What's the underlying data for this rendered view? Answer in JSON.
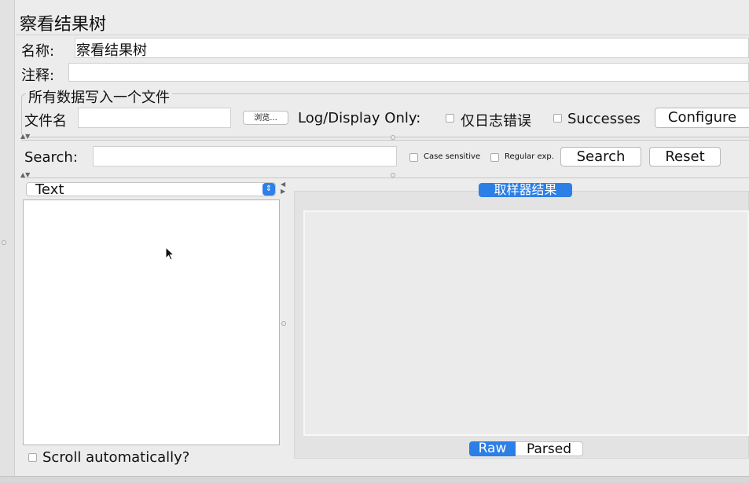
{
  "window": {
    "title": "察看结果树"
  },
  "form": {
    "name_label": "名称:",
    "name_value": "察看结果树",
    "comment_label": "注释:",
    "comment_value": ""
  },
  "file_section": {
    "legend": "所有数据写入一个文件",
    "file_label": "文件名",
    "file_value": "",
    "browse_label": "浏览...",
    "log_display_label": "Log/Display Only:",
    "errors_only_label": "仅日志错误",
    "successes_label": "Successes",
    "configure_label": "Configure"
  },
  "search": {
    "label": "Search:",
    "value": "",
    "case_sensitive_label": "Case sensitive",
    "regex_label": "Regular exp.",
    "search_button": "Search",
    "reset_button": "Reset"
  },
  "tree": {
    "renderer_selected": "Text",
    "scroll_auto_label": "Scroll automatically?"
  },
  "result": {
    "tab_label": "取样器结果",
    "raw_tab": "Raw",
    "parsed_tab": "Parsed"
  },
  "colors": {
    "accent": "#2b7fe6",
    "panel_bg": "#ececec"
  }
}
